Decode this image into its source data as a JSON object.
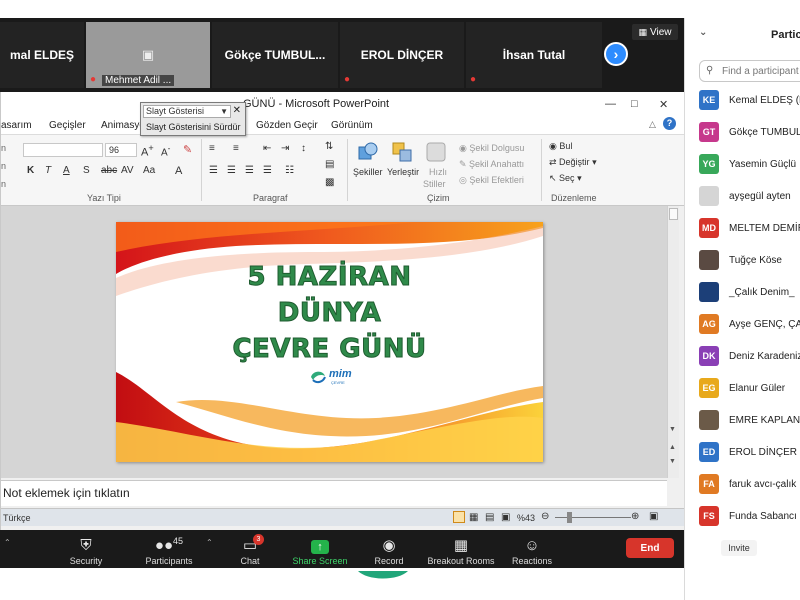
{
  "zoom": {
    "view_label": "View",
    "video_tiles": [
      {
        "name": "mal ELDEŞ",
        "muted": false
      },
      {
        "name": "Mehmet Adil ...",
        "muted": true,
        "video_off": true
      },
      {
        "name": "Gökçe TUMBUL...",
        "muted": false
      },
      {
        "name": "EROL DİNÇER",
        "muted": true
      },
      {
        "name": "İhsan Tutal",
        "muted": true
      }
    ],
    "toolbar": {
      "security": "Security",
      "participants": "Participants",
      "participants_count": "45",
      "chat": "Chat",
      "chat_badge": "3",
      "share_screen": "Share Screen",
      "record": "Record",
      "breakout_rooms": "Breakout Rooms",
      "reactions": "Reactions",
      "end": "End"
    },
    "panel": {
      "title": "Partici",
      "search_placeholder": "Find a participant",
      "invite": "Invite",
      "participants": [
        {
          "initials": "KE",
          "name": "Kemal ELDEŞ (H",
          "color": "#2f73c7"
        },
        {
          "initials": "GT",
          "name": "Gökçe TUMBUL",
          "color": "#c6388c"
        },
        {
          "initials": "YG",
          "name": "Yasemin Güçlü",
          "color": "#38a85a"
        },
        {
          "initials": "",
          "name": "ayşegül ayten",
          "color": "#d5d5d5"
        },
        {
          "initials": "MD",
          "name": "MELTEM DEMİR",
          "color": "#d7352b"
        },
        {
          "initials": "",
          "name": "Tuğçe Köse",
          "color": "#5a4a42"
        },
        {
          "initials": "",
          "name": "_Çalık Denim_",
          "color": "#1c3f78"
        },
        {
          "initials": "AG",
          "name": "Ayşe GENÇ, ÇAL",
          "color": "#e07a23"
        },
        {
          "initials": "DK",
          "name": "Deniz Karadeniz",
          "color": "#8a3fb5"
        },
        {
          "initials": "EG",
          "name": "Elanur Güler",
          "color": "#e8a91c"
        },
        {
          "initials": "",
          "name": "EMRE KAPLAN",
          "color": "#6b5a48"
        },
        {
          "initials": "ED",
          "name": "EROL DİNÇER",
          "color": "#2f73c7"
        },
        {
          "initials": "FA",
          "name": "faruk avcı-çalık",
          "color": "#e07a23"
        },
        {
          "initials": "FS",
          "name": "Funda Sabancı",
          "color": "#d7352b"
        }
      ]
    }
  },
  "powerpoint": {
    "title_partial": "GÜNÜ - Microsoft PowerPoint",
    "tabs": [
      "asarım",
      "Geçişler",
      "Animasyo",
      "Gözden Geçir",
      "Görünüm"
    ],
    "slideshow_popup": {
      "header": "Slayt Gösterisi",
      "item": "Slayt Gösterisini Sürdür"
    },
    "ribbon": {
      "font_size": "96",
      "group_font": "Yazı Tipi",
      "group_paragraph": "Paragraf",
      "group_drawing": "Çizim",
      "group_editing": "Düzenleme",
      "shapes": "Şekiller",
      "arrange": "Yerleştir",
      "quick_styles_1": "Hızlı",
      "quick_styles_2": "Stiller",
      "shape_fill": "Şekil Dolgusu",
      "shape_outline": "Şekil Anahattı",
      "shape_effects": "Şekil Efektleri",
      "find": "Bul",
      "replace": "Değiştir",
      "select": "Seç"
    },
    "slide": {
      "line1": "5 HAZİRAN",
      "line2": "DÜNYA",
      "line3": "ÇEVRE GÜNÜ",
      "logo_text": "mim",
      "logo_sub": "ÇEVRE"
    },
    "notes_placeholder": "Not eklemek için tıklatın",
    "status": {
      "language": "Türkçe",
      "zoom": "%43"
    }
  }
}
